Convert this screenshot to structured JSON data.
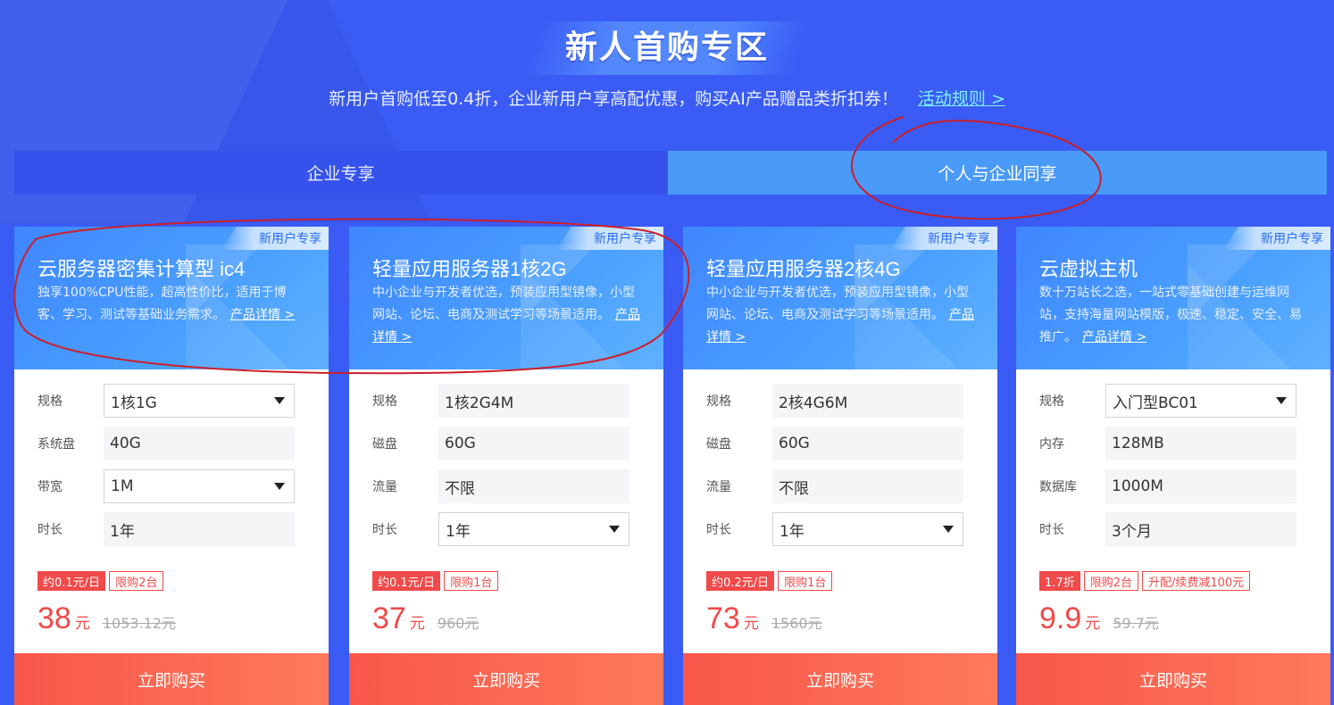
{
  "header": {
    "title": "新人首购专区",
    "subtitle": "新用户首购低至0.4折，企业新用户享高配优惠，购买AI产品赠品类折扣券！",
    "rules_link": "活动规则 >"
  },
  "tabs": [
    {
      "label": "企业专享",
      "active": false
    },
    {
      "label": "个人与企业同享",
      "active": true
    }
  ],
  "cards": [
    {
      "badge": "新用户专享",
      "title": "云服务器密集计算型 ic4",
      "desc": "独享100%CPU性能，超高性价比，适用于博客、学习、测试等基础业务需求。",
      "detail_link": "产品详情 >",
      "rows": [
        {
          "label": "规格",
          "value": "1核1G",
          "type": "select"
        },
        {
          "label": "系统盘",
          "value": "40G",
          "type": "static"
        },
        {
          "label": "带宽",
          "value": "1M",
          "type": "select"
        },
        {
          "label": "时长",
          "value": "1年",
          "type": "static"
        }
      ],
      "tags": [
        {
          "text": "约0.1元/日",
          "style": "filled"
        },
        {
          "text": "限购2台",
          "style": "outline"
        }
      ],
      "price": "38",
      "unit": "元",
      "old_price": "1053.12元",
      "buy_label": "立即购买"
    },
    {
      "badge": "新用户专享",
      "title": "轻量应用服务器1核2G",
      "desc": "中小企业与开发者优选，预装应用型镜像，小型网站、论坛、电商及测试学习等场景适用。",
      "detail_link": "产品详情 >",
      "rows": [
        {
          "label": "规格",
          "value": "1核2G4M",
          "type": "static"
        },
        {
          "label": "磁盘",
          "value": "60G",
          "type": "static"
        },
        {
          "label": "流量",
          "value": "不限",
          "type": "static"
        },
        {
          "label": "时长",
          "value": "1年",
          "type": "select"
        }
      ],
      "tags": [
        {
          "text": "约0.1元/日",
          "style": "filled"
        },
        {
          "text": "限购1台",
          "style": "outline"
        }
      ],
      "price": "37",
      "unit": "元",
      "old_price": "960元",
      "buy_label": "立即购买"
    },
    {
      "badge": "新用户专享",
      "title": "轻量应用服务器2核4G",
      "desc": "中小企业与开发者优选，预装应用型镜像，小型网站、论坛、电商及测试学习等场景适用。",
      "detail_link": "产品详情 >",
      "rows": [
        {
          "label": "规格",
          "value": "2核4G6M",
          "type": "static"
        },
        {
          "label": "磁盘",
          "value": "60G",
          "type": "static"
        },
        {
          "label": "流量",
          "value": "不限",
          "type": "static"
        },
        {
          "label": "时长",
          "value": "1年",
          "type": "select"
        }
      ],
      "tags": [
        {
          "text": "约0.2元/日",
          "style": "filled"
        },
        {
          "text": "限购1台",
          "style": "outline"
        }
      ],
      "price": "73",
      "unit": "元",
      "old_price": "1560元",
      "buy_label": "立即购买"
    },
    {
      "badge": "新用户专享",
      "title": "云虚拟主机",
      "desc": "数十万站长之选，一站式零基础创建与运维网站，支持海量网站模版，极速、稳定、安全、易推广。",
      "detail_link": "产品详情 >",
      "rows": [
        {
          "label": "规格",
          "value": "入门型BC01",
          "type": "select"
        },
        {
          "label": "内存",
          "value": "128MB",
          "type": "static"
        },
        {
          "label": "数据库",
          "value": "1000M",
          "type": "static"
        },
        {
          "label": "时长",
          "value": "3个月",
          "type": "static"
        }
      ],
      "tags": [
        {
          "text": "1.7折",
          "style": "filled"
        },
        {
          "text": "限购2台",
          "style": "outline"
        },
        {
          "text": "升配/续费减100元",
          "style": "outline"
        }
      ],
      "price": "9.9",
      "unit": "元",
      "old_price": "59.7元",
      "buy_label": "立即购买"
    }
  ],
  "colors": {
    "page_bg": "#3a5cf5",
    "active_tab": "#4a9af8",
    "accent_red": "#f04a4a",
    "annotation": "#cc1f2a"
  }
}
